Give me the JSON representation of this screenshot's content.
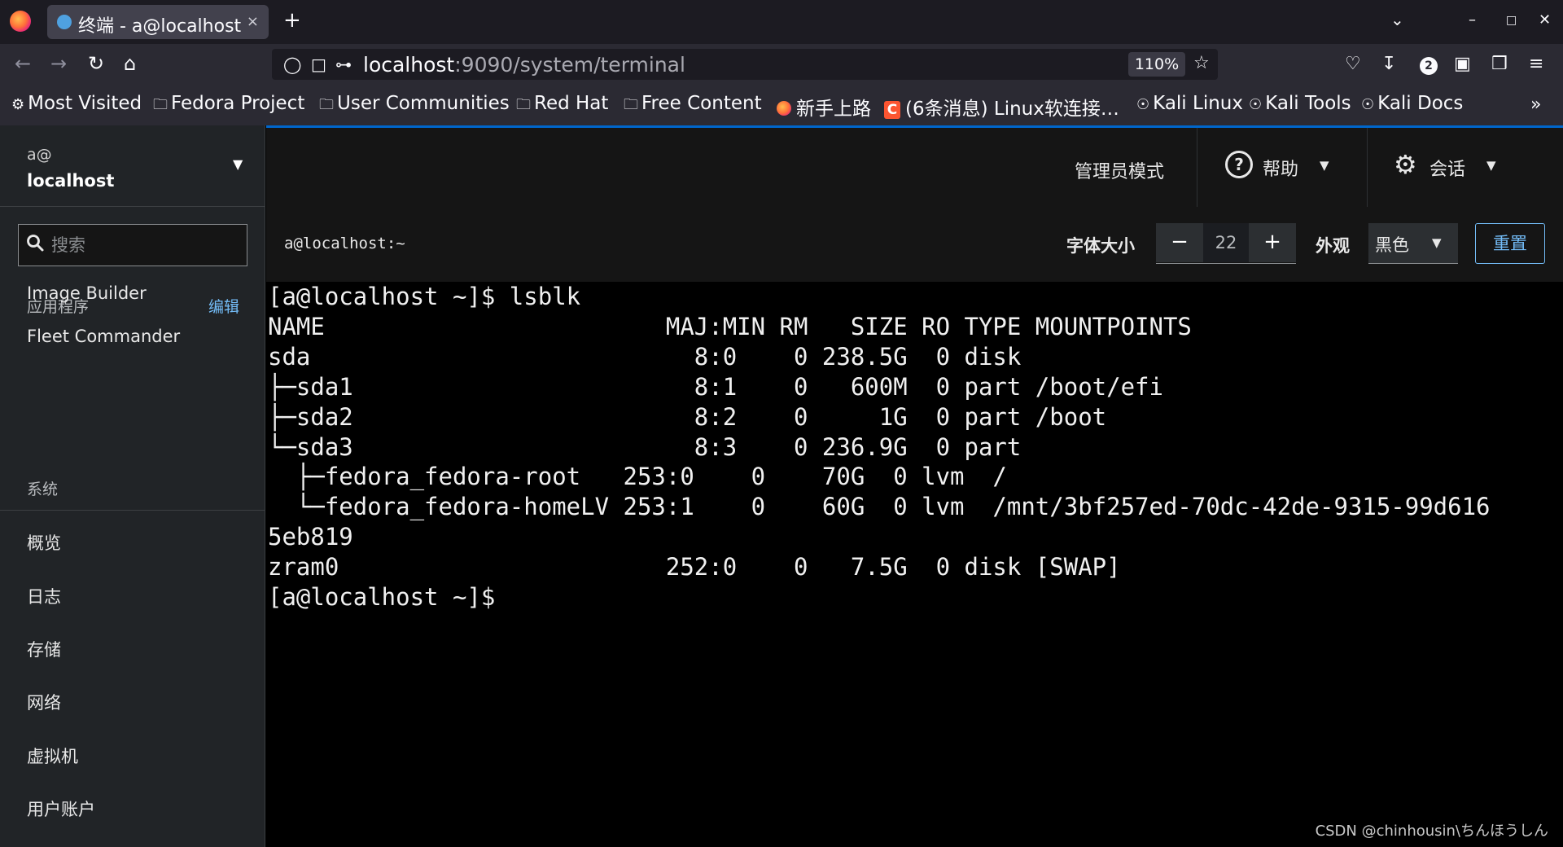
{
  "browser": {
    "tab_title": "终端 - a@localhost",
    "tab_close": "×",
    "new_tab": "+",
    "url_host": "localhost",
    "url_rest": ":9090/system/terminal",
    "zoom": "110%",
    "notification_count": "2",
    "bookmarks": [
      {
        "label": "Most Visited",
        "icon": "gear-icon"
      },
      {
        "label": "Fedora Project",
        "icon": "folder-icon"
      },
      {
        "label": "User Communities",
        "icon": "folder-icon"
      },
      {
        "label": "Red Hat",
        "icon": "folder-icon"
      },
      {
        "label": "Free Content",
        "icon": "folder-icon"
      },
      {
        "label": "新手上路",
        "icon": "firefox-icon"
      },
      {
        "label": "(6条消息) Linux软连接…",
        "icon": "csdn-icon"
      },
      {
        "label": "Kali Linux",
        "icon": "globe-icon"
      },
      {
        "label": "Kali Tools",
        "icon": "globe-icon"
      },
      {
        "label": "Kali Docs",
        "icon": "globe-icon"
      }
    ]
  },
  "sidebar": {
    "host_user": "a@",
    "host_name": "localhost",
    "search_placeholder": "搜索",
    "apps_header": "应用程序",
    "apps_edit": "编辑",
    "apps": [
      "Image Builder",
      "Fleet Commander"
    ],
    "system_header": "系统",
    "system_items": [
      "概览",
      "日志",
      "存储",
      "网络",
      "虚拟机",
      "用户账户"
    ]
  },
  "masthead": {
    "admin_mode": "管理员模式",
    "help": "帮助",
    "session": "会话"
  },
  "terminal": {
    "title": "a@localhost:~",
    "font_size_label": "字体大小",
    "font_size_value": "22",
    "appearance_label": "外观",
    "appearance_value": "黑色",
    "reset_label": "重置",
    "lines": [
      "[a@localhost ~]$ lsblk",
      "NAME                        MAJ:MIN RM   SIZE RO TYPE MOUNTPOINTS",
      "sda                           8:0    0 238.5G  0 disk",
      "├─sda1                        8:1    0   600M  0 part /boot/efi",
      "├─sda2                        8:2    0     1G  0 part /boot",
      "└─sda3                        8:3    0 236.9G  0 part",
      "  ├─fedora_fedora-root   253:0    0    70G  0 lvm  /",
      "  └─fedora_fedora-homeLV 253:1    0    60G  0 lvm  /mnt/3bf257ed-70dc-42de-9315-99d616",
      "5eb819",
      "zram0                       252:0    0   7.5G  0 disk [SWAP]",
      "[a@localhost ~]$"
    ]
  },
  "watermark": "CSDN @chinhousin\\ちんほうしん",
  "colors": {
    "accent": "#0066cc",
    "link": "#73bcf7",
    "sidebar_bg": "#212427",
    "terminal_bg": "#000000"
  }
}
